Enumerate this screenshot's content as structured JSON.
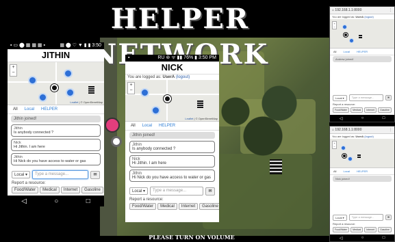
{
  "banner": {
    "title": "HELPER NETWORK",
    "footer": "PLEASE TURN ON VOLUME"
  },
  "colors": {
    "accent": "#2a7bd4",
    "marker": "#2d6fd6"
  },
  "phone_j": {
    "status_left": "▪ ▭ ⬤ ▦ ▦ ▦ ▪",
    "status_right": "▦ ⬤ ♡ ▼ ▮ ▮ 3:50",
    "user": "JITHIN",
    "map_attrib_leaflet": "Leaflet",
    "map_attrib_osm": "| © OpenStreetMap",
    "tabs": [
      "All",
      "Local",
      "HELPER"
    ],
    "joined": "Jithin joined!",
    "messages": [
      {
        "who": "Jithin",
        "text": "Is anybody connected ?"
      },
      {
        "who": "Nick",
        "text": "Hi Jithin. I am here"
      },
      {
        "who": "Jithin",
        "text": "Hi Nick do you have access to water or gas"
      }
    ],
    "composer": {
      "scope": "Local",
      "placeholder": "Type a message..."
    },
    "report_label": "Report a resource:",
    "resources": [
      "Food/Water",
      "Medical",
      "Internet",
      "Gasoline"
    ]
  },
  "phone_n": {
    "status_left": "▪",
    "status_right": "RU ⊚ ᯤ ▮▮ 76% ▮ 3:50 PM",
    "user": "NICK",
    "logged_text": "You are logged as:",
    "logged_user": "UserA",
    "logout": "(logout)",
    "map_attrib_leaflet": "Leaflet",
    "map_attrib_osm": "| © OpenStreetMap",
    "tabs": [
      "All",
      "Local",
      "HELPER"
    ],
    "joined": "Jithin joined!",
    "messages": [
      {
        "who": "Jithin",
        "text": "Is anybody connected ?"
      },
      {
        "who": "Nick",
        "text": "Hi Jithin. I am here"
      },
      {
        "who": "Jithin",
        "text": "Hi Nick do you have access to water or gas"
      }
    ],
    "composer": {
      "scope": "Local",
      "placeholder": "Type a message..."
    },
    "report_label": "Report a resource:",
    "resources": [
      "Food/Water",
      "Medical",
      "Internet",
      "Gasoline"
    ]
  },
  "browser_1": {
    "url": "192.168.1.1:8000",
    "logged_text": "You are logged as:",
    "logged_user": "UserA",
    "logout": "(logout)",
    "tabs": [
      "All",
      "Local",
      "HELPER"
    ],
    "joined": "Andrew joined!",
    "composer": {
      "scope": "Local",
      "placeholder": "Type a message..."
    },
    "report_label": "Report a resource:",
    "resources": [
      "Food/Water",
      "Medical",
      "Internet",
      "Gasoline"
    ]
  },
  "browser_2": {
    "url": "192.168.1.1:8000",
    "logged_text": "You are logged as:",
    "logged_user": "UserA",
    "logout": "(logout)",
    "tabs": [
      "All",
      "Local",
      "HELPER"
    ],
    "joined": "Nick joined!",
    "composer": {
      "scope": "Local",
      "placeholder": "Type a message..."
    },
    "report_label": "Report a resource:",
    "resources": [
      "Food/Water",
      "Medical",
      "Internet",
      "Gasoline"
    ]
  }
}
